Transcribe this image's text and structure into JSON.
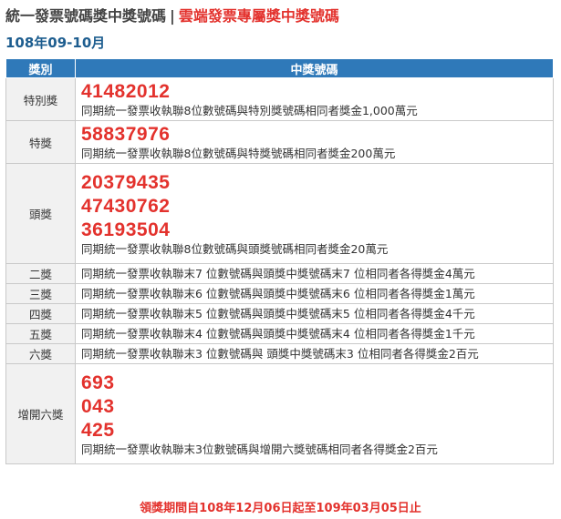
{
  "header": {
    "title_left": "統一發票號碼獎中獎號碼",
    "separator": "|",
    "title_right": "雲端發票專屬獎中獎號碼"
  },
  "period": "108年09-10月",
  "table": {
    "col_category": "獎別",
    "col_numbers": "中獎號碼",
    "rows": [
      {
        "category": "特別獎",
        "numbers": [
          "41482012"
        ],
        "desc": "同期統一發票收執聯8位數號碼與特別獎號碼相同者獎金1,000萬元"
      },
      {
        "category": "特獎",
        "numbers": [
          "58837976"
        ],
        "desc": "同期統一發票收執聯8位數號碼與特獎號碼相同者獎金200萬元"
      },
      {
        "category": "頭獎",
        "numbers": [
          "20379435",
          "47430762",
          "36193504"
        ],
        "desc": "同期統一發票收執聯8位數號碼與頭獎號碼相同者獎金20萬元"
      },
      {
        "category": "二獎",
        "desc": "同期統一發票收執聯末7 位數號碼與頭獎中獎號碼末7 位相同者各得獎金4萬元"
      },
      {
        "category": "三獎",
        "desc": "同期統一發票收執聯末6 位數號碼與頭獎中獎號碼末6 位相同者各得獎金1萬元"
      },
      {
        "category": "四獎",
        "desc": "同期統一發票收執聯末5 位數號碼與頭獎中獎號碼末5 位相同者各得獎金4千元"
      },
      {
        "category": "五獎",
        "desc": "同期統一發票收執聯末4 位數號碼與頭獎中獎號碼末4 位相同者各得獎金1千元"
      },
      {
        "category": "六獎",
        "desc": "同期統一發票收執聯末3 位數號碼與 頭獎中獎號碼末3 位相同者各得獎金2百元"
      },
      {
        "category": "增開六獎",
        "numbers": [
          "693",
          "043",
          "425"
        ],
        "desc": "同期統一發票收執聯末3位數號碼與增開六獎號碼相同者各得獎金2百元"
      }
    ]
  },
  "footer": "領獎期間自108年12月06日起至109年03月05日止",
  "colors": {
    "accent_red": "#e3322d",
    "header_blue": "#2f79b9",
    "period_blue": "#1d5d8f"
  }
}
